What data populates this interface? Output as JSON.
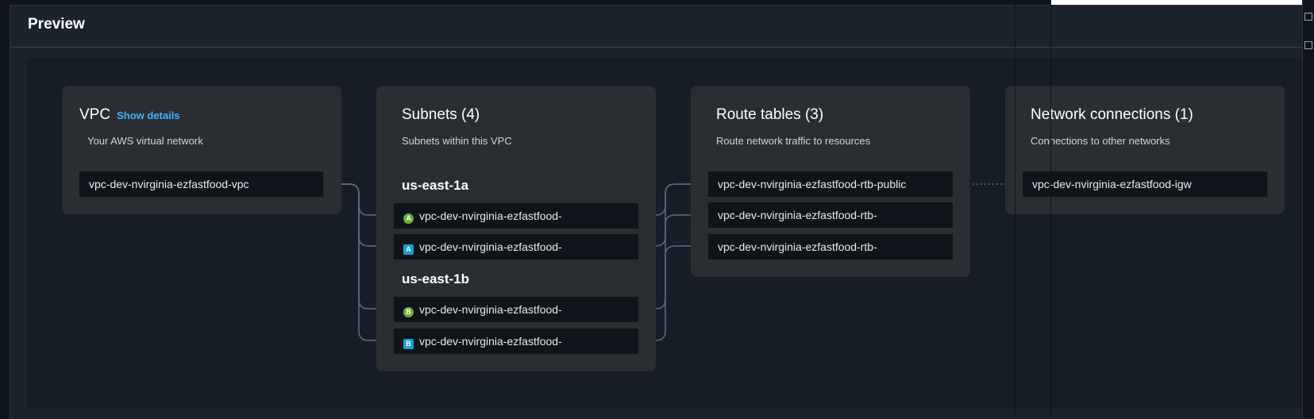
{
  "panel": {
    "title": "Preview"
  },
  "vpc": {
    "title": "VPC",
    "show_details": "Show details",
    "subtitle": "Your AWS virtual network",
    "name": "vpc-dev-nvirginia-ezfastfood-vpc"
  },
  "subnets": {
    "title": "Subnets (4)",
    "subtitle": "Subnets within this VPC",
    "zones": [
      {
        "name": "us-east-1a",
        "items": [
          {
            "badge": "A",
            "badge_shape": "round",
            "badge_color": "#6aaf35",
            "label": "vpc-dev-nvirginia-ezfastfood-"
          },
          {
            "badge": "A",
            "badge_shape": "square",
            "badge_color": "#1a9fd0",
            "label": "vpc-dev-nvirginia-ezfastfood-"
          }
        ]
      },
      {
        "name": "us-east-1b",
        "items": [
          {
            "badge": "B",
            "badge_shape": "round",
            "badge_color": "#6aaf35",
            "label": "vpc-dev-nvirginia-ezfastfood-"
          },
          {
            "badge": "B",
            "badge_shape": "square",
            "badge_color": "#1a9fd0",
            "label": "vpc-dev-nvirginia-ezfastfood-"
          }
        ]
      }
    ]
  },
  "route_tables": {
    "title": "Route tables (3)",
    "subtitle": "Route network traffic to resources",
    "items": [
      "vpc-dev-nvirginia-ezfastfood-rtb-public",
      "vpc-dev-nvirginia-ezfastfood-rtb-",
      "vpc-dev-nvirginia-ezfastfood-rtb-"
    ]
  },
  "network_connections": {
    "title": "Network connections (1)",
    "subtitle": "Connections to other networks",
    "items": [
      "vpc-dev-nvirginia-ezfastfood-igw"
    ]
  },
  "colors": {
    "background": "#0f141a",
    "panel": "#1b232d",
    "card": "#2a2e33",
    "node": "#0f141a",
    "link": "#42b4ff",
    "connector": "#5f6b7a"
  }
}
